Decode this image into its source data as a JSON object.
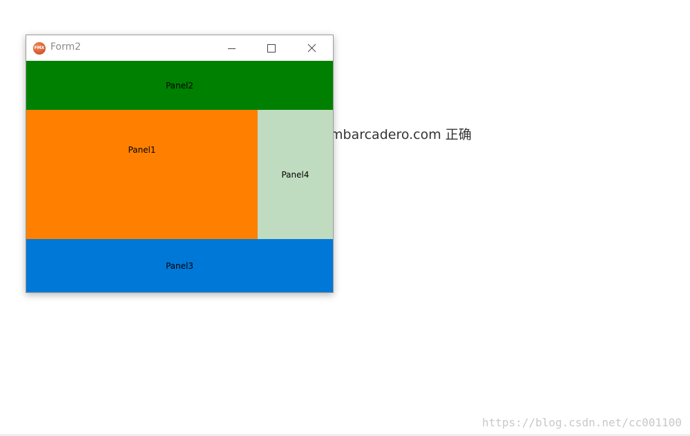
{
  "background": {
    "text": "mbarcadero.com 正确",
    "watermark": "https://blog.csdn.net/cc001100"
  },
  "window": {
    "title": "Form2",
    "icon": "fmx-app-icon",
    "icon_text": "FMX",
    "controls": {
      "minimize": "minimize-icon",
      "maximize": "maximize-icon",
      "close": "close-icon"
    },
    "panels": {
      "panel2": {
        "label": "Panel2",
        "color": "#008000"
      },
      "panel1": {
        "label": "Panel1",
        "color": "#ff8000"
      },
      "panel4": {
        "label": "Panel4",
        "color": "#c0dcc0"
      },
      "panel3": {
        "label": "Panel3",
        "color": "#0078d7"
      }
    }
  }
}
